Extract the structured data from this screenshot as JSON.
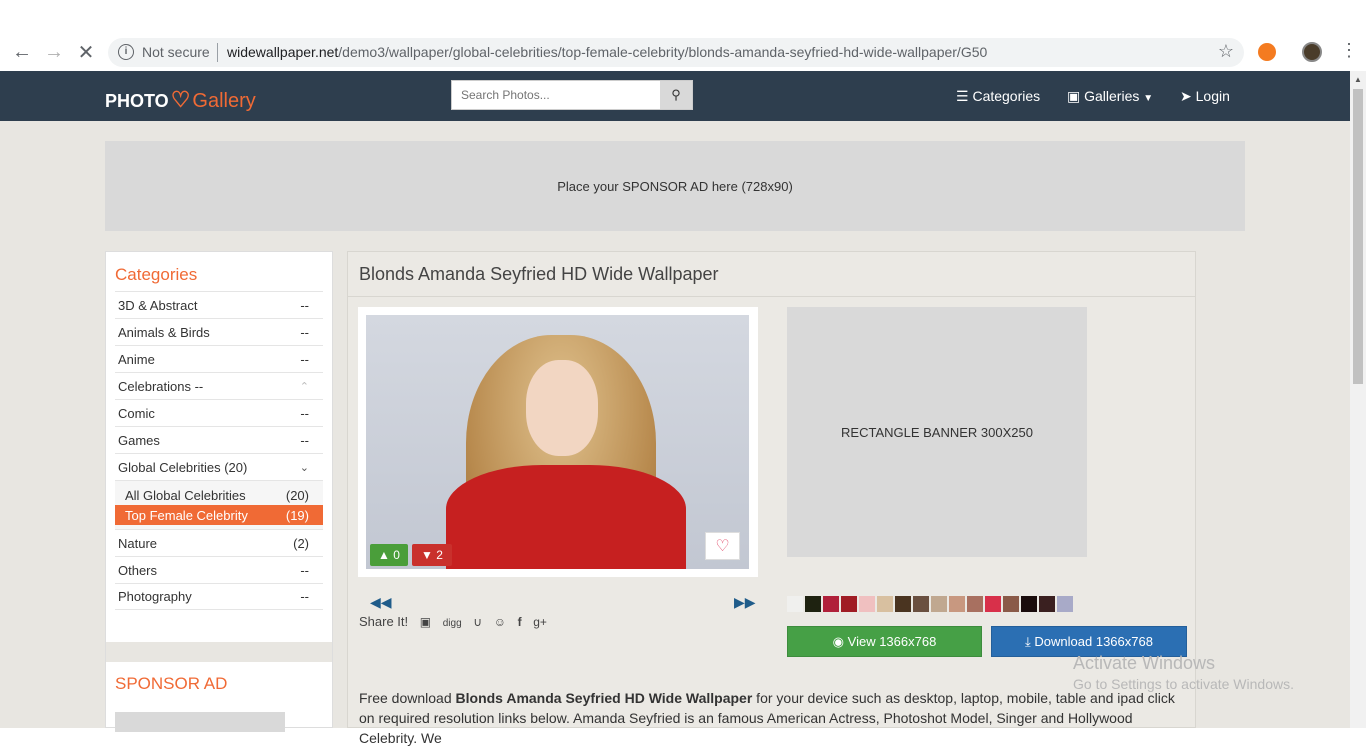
{
  "browser": {
    "not_secure": "Not secure",
    "url_host": "widewallpaper.net",
    "url_path": "/demo3/wallpaper/global-celebrities/top-female-celebrity/blonds-amanda-seyfried-hd-wide-wallpaper/G50"
  },
  "header": {
    "logo_photo": "PHOTO",
    "logo_gallery": "Gallery",
    "search_placeholder": "Search Photos...",
    "categories": "Categories",
    "galleries": "Galleries",
    "login": "Login"
  },
  "ad_banner": "Place your SPONSOR AD here (728x90)",
  "sidebar": {
    "title": "Categories",
    "items": [
      {
        "label": "3D & Abstract",
        "count": "--"
      },
      {
        "label": "Animals & Birds",
        "count": "--"
      },
      {
        "label": "Anime",
        "count": "--"
      },
      {
        "label": "Celebrations --",
        "count": "^"
      },
      {
        "label": "Comic",
        "count": "--"
      },
      {
        "label": "Games",
        "count": "--"
      },
      {
        "label": "Global Celebrities (20)",
        "count": "v"
      }
    ],
    "sub": [
      {
        "label": "All Global Celebrities",
        "count": "(20)"
      },
      {
        "label": "Top Female Celebrity",
        "count": "(19)"
      }
    ],
    "items2": [
      {
        "label": "Nature",
        "count": "(2)"
      },
      {
        "label": "Others",
        "count": "--"
      },
      {
        "label": "Photography",
        "count": "--"
      }
    ],
    "sponsor_title": "SPONSOR AD"
  },
  "main": {
    "title": "Blonds Amanda Seyfried HD Wide Wallpaper",
    "likes": "0",
    "dislikes": "2",
    "rect_ad": "RECTANGLE BANNER 300X250",
    "share_label": "Share It!",
    "view_btn": "View 1366x768",
    "download_btn": "Download 1366x768",
    "desc_pre": "Free download ",
    "desc_bold": "Blonds Amanda Seyfried HD Wide Wallpaper",
    "desc_post": " for your device such as desktop, laptop, mobile, table and ipad click on required resolution links below. Amanda Seyfried is an famous American Actress, Photoshot Model, Singer and Hollywood Celebrity. We"
  },
  "swatch_colors": [
    "#f0f0ee",
    "#1e2210",
    "#b0203a",
    "#a01c24",
    "#f0c0c0",
    "#d8c0a0",
    "#4a3420",
    "#6a5040",
    "#c0a890",
    "#c89880",
    "#a87060",
    "#d8304a",
    "#8a5a48",
    "#1a0c0c",
    "#3a2020",
    "#a8aac8"
  ],
  "watermark": {
    "line1": "Activate Windows",
    "line2": "Go to Settings to activate Windows."
  }
}
